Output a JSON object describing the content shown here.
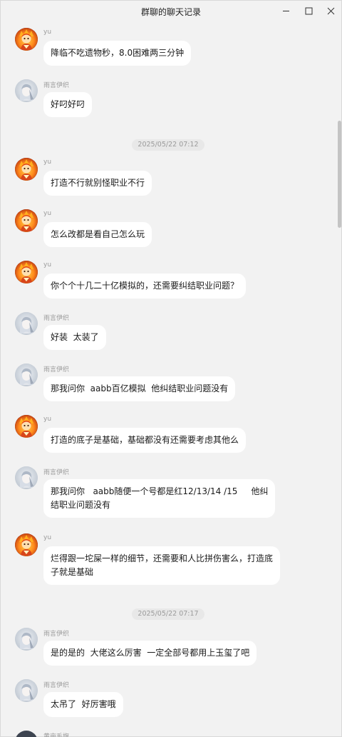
{
  "window": {
    "title": "群聊的聊天记录",
    "minimize_icon": "minimize-icon",
    "maximize_icon": "maximize-icon",
    "close_icon": "close-icon"
  },
  "users": {
    "yu": {
      "name": "yu",
      "avatar": "flame-character-avatar"
    },
    "yuyan": {
      "name": "雨言伊织",
      "avatar": "pale-girl-avatar"
    },
    "partial": {
      "name": "黄亩毛旗"
    }
  },
  "timestamps": [
    "2025/05/22 07:12",
    "2025/05/22 07:17"
  ],
  "messages": [
    {
      "sender": "yu",
      "text": "降临不吃遗物秒，8.0困难两三分钟"
    },
    {
      "sender": "雨言伊织",
      "text": "好叼好叼"
    },
    {
      "sender": "yu",
      "text": "打造不行就别怪职业不行"
    },
    {
      "sender": "yu",
      "text": "怎么改都是看自己怎么玩"
    },
    {
      "sender": "yu",
      "text": "你个个十几二十亿模拟的，还需要纠结职业问题？"
    },
    {
      "sender": "雨言伊织",
      "text": "好装  太装了"
    },
    {
      "sender": "雨言伊织",
      "text": "那我问你  aabb百亿模拟  他纠结职业问题没有"
    },
    {
      "sender": "yu",
      "text": "打造的底子是基础，基础都没有还需要考虑其他么"
    },
    {
      "sender": "雨言伊织",
      "text": "那我问你   aabb随便一个号都是红12/13/14 /15     他纠\n结职业问题没有"
    },
    {
      "sender": "yu",
      "text": "烂得跟一坨屎一样的细节，还需要和人比拼伤害么，打造底\n子就是基础"
    },
    {
      "sender": "雨言伊织",
      "text": "是的是的  大佬这么厉害  一定全部号都用上玉玺了吧"
    },
    {
      "sender": "雨言伊织",
      "text": "太吊了  好厉害哦"
    }
  ]
}
